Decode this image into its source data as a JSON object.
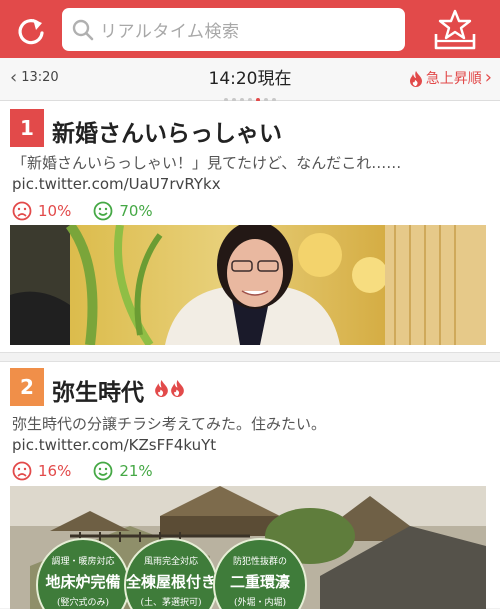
{
  "header": {
    "search_placeholder": "リアルタイム検索"
  },
  "timebar": {
    "prev_time": "13:20",
    "current_time": "14:20現在",
    "pages": 7,
    "active_page": 5,
    "rising_label": "急上昇順"
  },
  "items": [
    {
      "rank": "1",
      "title": "新婚さんいらっしゃい",
      "trending_flames": 0,
      "description": "「新婚さんいらっしゃい！」見てたけど、なんだこれ……",
      "url": "pic.twitter.com/UaU7rvRYkx",
      "negative_pct": "10%",
      "positive_pct": "70%"
    },
    {
      "rank": "2",
      "title": "弥生時代",
      "trending_flames": 2,
      "description": "弥生時代の分譲チラシ考えてみた。住みたい。",
      "url": "pic.twitter.com/KZsFF4kuYt",
      "negative_pct": "16%",
      "positive_pct": "21%",
      "flyer_badges": [
        {
          "top": "調理・暖房対応",
          "main": "地床炉完備",
          "sub": "(竪穴式のみ)"
        },
        {
          "top": "風雨完全対応",
          "main": "全棟屋根付き",
          "sub": "(土、茅選択可)"
        },
        {
          "top": "防犯性抜群の",
          "main": "二重環濠",
          "sub": "(外堀・内堀)"
        }
      ]
    }
  ],
  "colors": {
    "brand_red": "#e24a4a",
    "rank2_orange": "#f08f49",
    "positive_green": "#45a845"
  }
}
